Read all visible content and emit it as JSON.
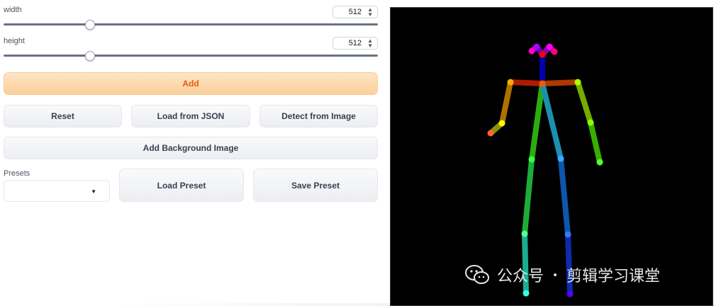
{
  "width_control": {
    "label": "width",
    "value": "512",
    "slider_fraction": 0.23
  },
  "height_control": {
    "label": "height",
    "value": "512",
    "slider_fraction": 0.23
  },
  "buttons": {
    "add": "Add",
    "reset": "Reset",
    "load_json": "Load from JSON",
    "detect_image": "Detect from Image",
    "add_background": "Add Background Image",
    "load_preset": "Load Preset",
    "save_preset": "Save Preset"
  },
  "presets": {
    "label": "Presets",
    "value": ""
  },
  "watermark": {
    "text_left": "公众号",
    "text_right": "剪辑学习课堂"
  },
  "colors": {
    "accent": "#ea580c",
    "primary_bg": "#fbcf9a",
    "canvas_bg": "#000000"
  },
  "icons": {
    "spinner": "up-down-arrows-icon",
    "dropdown": "caret-down-icon",
    "watermark_logo": "wechat-icon"
  }
}
